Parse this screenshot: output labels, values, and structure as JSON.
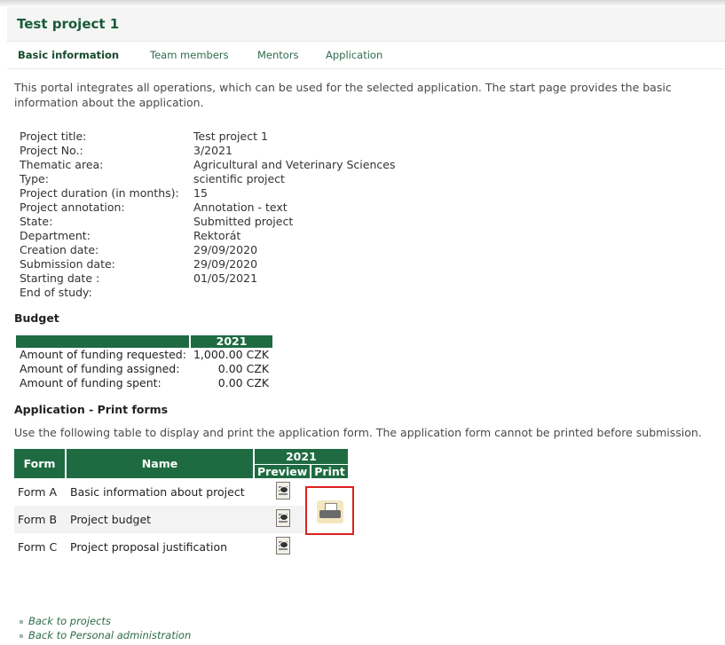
{
  "page": {
    "title": "Test project 1",
    "tabs": [
      {
        "label": "Basic information",
        "active": true
      },
      {
        "label": "Team members",
        "active": false
      },
      {
        "label": "Mentors",
        "active": false
      },
      {
        "label": "Application",
        "active": false
      }
    ],
    "intro": "This portal integrates all operations, which can be used for the selected application. The start page provides the basic information about the application."
  },
  "info": [
    {
      "label": "Project title:",
      "value": "Test project 1"
    },
    {
      "label": "Project No.:",
      "value": "3/2021"
    },
    {
      "label": "Thematic area:",
      "value": "Agricultural and Veterinary Sciences"
    },
    {
      "label": "Type:",
      "value": "scientific project"
    },
    {
      "label": "Project duration (in months):",
      "value": "15"
    },
    {
      "label": "Project annotation:",
      "value": "Annotation - text"
    },
    {
      "label": "State:",
      "value": "Submitted project"
    },
    {
      "label": "Department:",
      "value": "Rektorát"
    },
    {
      "label": "Creation date:",
      "value": "29/09/2020"
    },
    {
      "label": "Submission date:",
      "value": "29/09/2020"
    },
    {
      "label": "Starting date :",
      "value": "01/05/2021"
    },
    {
      "label": "End of study:",
      "value": ""
    }
  ],
  "budget": {
    "heading": "Budget",
    "year": "2021",
    "rows": [
      {
        "label": "Amount of funding requested:",
        "value": "1,000.00 CZK"
      },
      {
        "label": "Amount of funding assigned:",
        "value": "0.00 CZK"
      },
      {
        "label": "Amount of funding spent:",
        "value": "0.00 CZK"
      }
    ]
  },
  "print_forms": {
    "heading": "Application - Print forms",
    "intro": "Use the following table to display and print the application form. The application form cannot be printed before submission.",
    "col_form": "Form",
    "col_name": "Name",
    "year": "2021",
    "col_preview": "Preview",
    "col_print": "Print",
    "rows": [
      {
        "form": "Form A",
        "name": "Basic information about project"
      },
      {
        "form": "Form B",
        "name": "Project budget"
      },
      {
        "form": "Form C",
        "name": "Project proposal justification"
      }
    ]
  },
  "links": [
    {
      "label": "Back to projects"
    },
    {
      "label": "Back to Personal administration"
    }
  ],
  "colors": {
    "accent": "#1e6b42",
    "highlight": "#e02020"
  }
}
